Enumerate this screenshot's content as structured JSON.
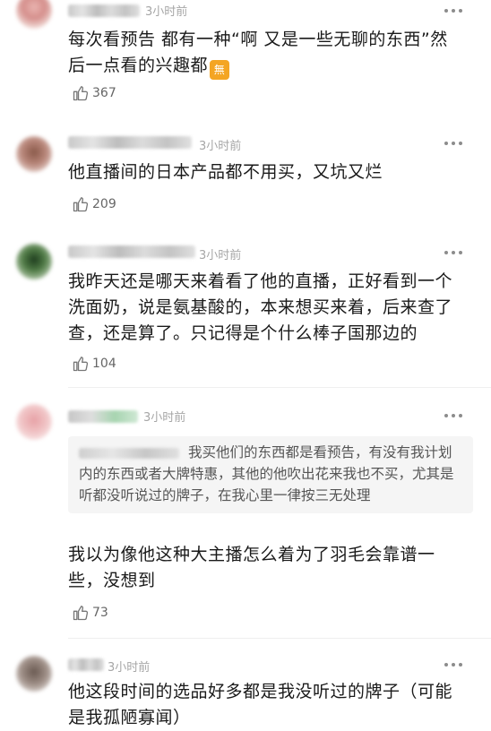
{
  "comments": [
    {
      "time": "3小时前",
      "text": "每次看预告 都有一种“啊 又是一些无聊的东西”然后一点看的兴趣都",
      "emoji": "無",
      "likes": "367"
    },
    {
      "time": "3小时前",
      "text": "他直播间的日本产品都不用买，又坑又烂",
      "likes": "209"
    },
    {
      "time": "3小时前",
      "text": "我昨天还是哪天来着看了他的直播，正好看到一个洗面奶，说是氨基酸的，本来想买来着，后来查了查，还是算了。只记得是个什么棒子国那边的",
      "likes": "104"
    },
    {
      "time": "3小时前",
      "quote": "我买他们的东西都是看预告，有没有我计划内的东西或者大牌特惠，其他的他吹出花来我也不买，尤其是听都没听说过的牌子，在我心里一律按三无处理",
      "text": "我以为像他这种大主播怎么着为了羽毛会靠谱一些，没想到",
      "likes": "73"
    },
    {
      "time": "3小时前",
      "text": "他这段时间的选品好多都是我没听过的牌子（可能是我孤陋寡闻）"
    }
  ]
}
